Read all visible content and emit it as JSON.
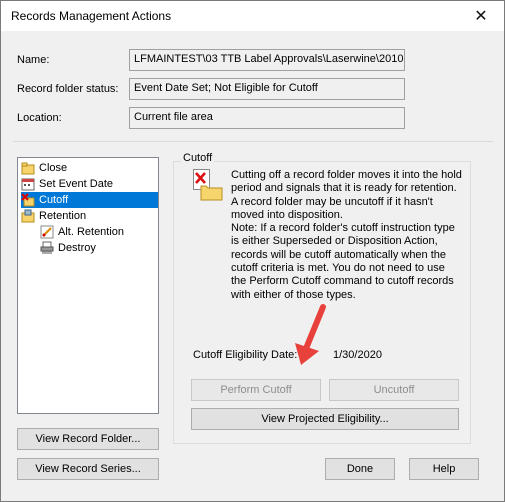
{
  "window": {
    "title": "Records Management Actions",
    "close_glyph": "✕"
  },
  "fields": {
    "name_label": "Name:",
    "name_value": "LFMAINTEST\\03 TTB Label Approvals\\Laserwine\\2010 -",
    "status_label": "Record folder status:",
    "status_value": "Event Date Set; Not Eligible for Cutoff",
    "location_label": "Location:",
    "location_value": "Current file area"
  },
  "tree": {
    "items": [
      {
        "label": "Close",
        "icon": "close-folder-icon"
      },
      {
        "label": "Set Event Date",
        "icon": "calendar-icon"
      },
      {
        "label": "Cutoff",
        "icon": "cutoff-icon",
        "selected": true
      },
      {
        "label": "Retention",
        "icon": "retention-icon"
      },
      {
        "label": "Alt. Retention",
        "icon": "alt-retention-icon"
      },
      {
        "label": "Destroy",
        "icon": "shredder-icon"
      }
    ]
  },
  "panel": {
    "group_label": "Cutoff",
    "description": "Cutting off a record folder moves it into the hold period and signals that it is ready for retention. A record folder may be uncutoff if it hasn't moved into disposition.\nNote: If a record folder's cutoff instruction type is either Superseded or Disposition Action, records will be cutoff automatically when the cutoff criteria is met.  You do not need to use the Perform Cutoff command to cutoff records with either of those types.",
    "eligibility_label": "Cutoff Eligibility Date:",
    "eligibility_date": "1/30/2020",
    "perform_cutoff": "Perform Cutoff",
    "uncutoff": "Uncutoff",
    "view_projected": "View Projected Eligibility..."
  },
  "buttons": {
    "view_record_folder": "View Record Folder...",
    "view_record_series": "View Record Series...",
    "done": "Done",
    "help": "Help"
  },
  "colors": {
    "selection": "#0078d7",
    "annotation_arrow": "#e8403a"
  }
}
